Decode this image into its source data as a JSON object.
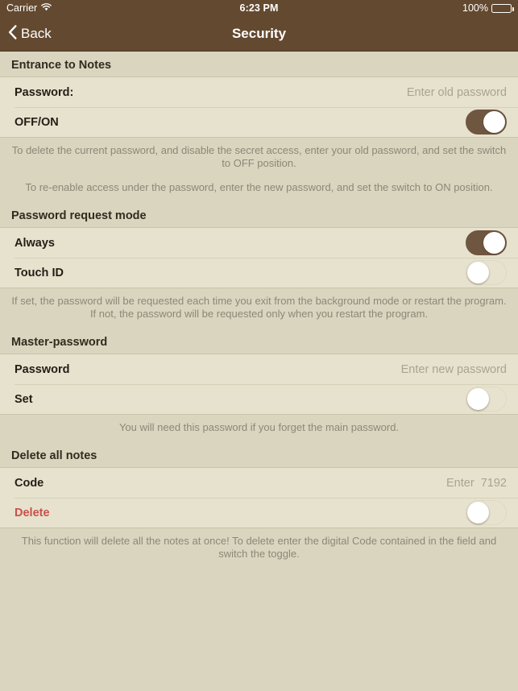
{
  "status_bar": {
    "carrier": "Carrier",
    "wifi_icon": "wifi-icon",
    "time": "6:23 PM",
    "battery_percent": "100%",
    "battery_icon": "battery-full-icon"
  },
  "nav_bar": {
    "back_label": "Back",
    "back_icon": "chevron-left-icon",
    "title": "Security"
  },
  "colors": {
    "nav_bar": "#63492f",
    "page_background": "#d9d5be",
    "row_background": "#e7e2ce",
    "switch_on": "#6f5640",
    "danger": "#c94f4a",
    "placeholder": "#a9a491",
    "footer_text": "#8d8878"
  },
  "sections": [
    {
      "header": "Entrance to Notes",
      "rows": [
        {
          "label": "Password:",
          "type": "text-field",
          "value": "",
          "placeholder": "Enter old password"
        },
        {
          "label": "OFF/ON",
          "type": "switch",
          "state": "on"
        }
      ],
      "footer": [
        "To delete the current password, and disable the secret access, enter your old password, and set the switch to OFF position.",
        "To re-enable access under the password, enter the new password, and set the switch to ON position."
      ]
    },
    {
      "header": "Password request mode",
      "rows": [
        {
          "label": "Always",
          "type": "switch",
          "state": "on"
        },
        {
          "label": "Touch ID",
          "type": "switch",
          "state": "off"
        }
      ],
      "footer": [
        "If set, the password will be requested each time you exit from the background mode or restart the program. If not, the password will be requested only when you restart the program."
      ]
    },
    {
      "header": "Master-password",
      "rows": [
        {
          "label": "Password",
          "type": "text-field",
          "value": "",
          "placeholder": "Enter new password"
        },
        {
          "label": "Set",
          "type": "switch",
          "state": "off"
        }
      ],
      "footer": [
        "You will need this password if you forget the main password."
      ]
    },
    {
      "header": "Delete all notes",
      "rows": [
        {
          "label": "Code",
          "type": "text-field",
          "value": "",
          "placeholder": "Enter  7192"
        },
        {
          "label": "Delete",
          "type": "switch",
          "state": "off",
          "style": "danger"
        }
      ],
      "footer": [
        "This function will delete all the notes at once! To delete enter the digital Code contained in the field and switch the toggle."
      ]
    }
  ]
}
